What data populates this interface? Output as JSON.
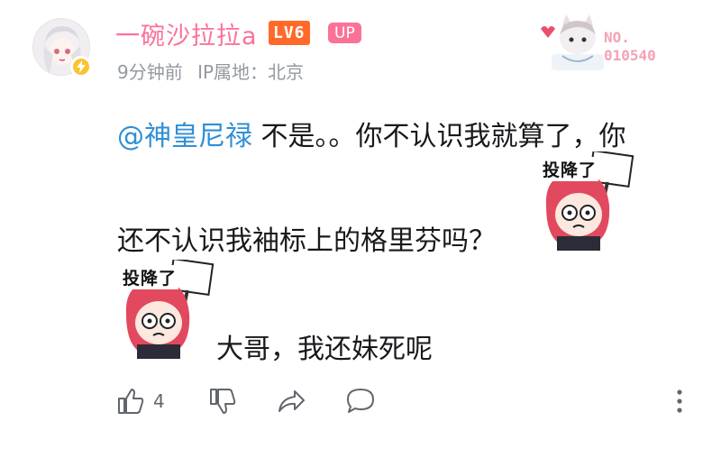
{
  "user": {
    "name": "一碗沙拉拉a",
    "level": "LV6",
    "up_badge": "UP",
    "time": "9分钟前",
    "ip_location": "IP属地：北京"
  },
  "decoration": {
    "number": "NO.\n010540"
  },
  "comment": {
    "mention": "@神皇尼禄",
    "line1_text": " 不是。。你不认识我就算了，你",
    "line2_text": "还不认识我袖标上的格里芬吗？",
    "line3_text": "大哥，我还妹死呢"
  },
  "stickers": {
    "sticker_1_caption": "投降了",
    "sticker_2_caption": "投降了"
  },
  "actions": {
    "like_count": "4"
  },
  "colors": {
    "username": "#fb7299",
    "level_badge": "#ff6a2a",
    "mention": "#2f8fd6",
    "meta": "#9499a0"
  }
}
